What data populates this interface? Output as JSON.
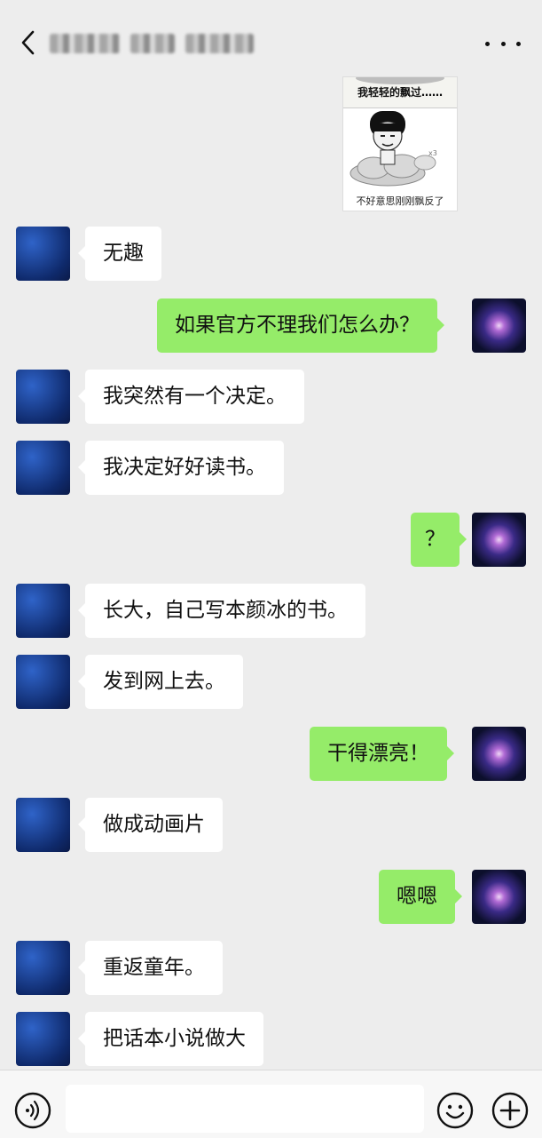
{
  "header": {
    "title_blurred": true
  },
  "sticker": {
    "caption_top": "我轻轻的飘过……",
    "caption_bottom": "不好意思刚刚飘反了"
  },
  "messages": [
    {
      "side": "left",
      "text": "无趣"
    },
    {
      "side": "right",
      "text": "如果官方不理我们怎么办？"
    },
    {
      "side": "left",
      "text": "我突然有一个决定。"
    },
    {
      "side": "left",
      "text": "我决定好好读书。"
    },
    {
      "side": "right",
      "text": "？"
    },
    {
      "side": "left",
      "text": "长大，自己写本颜冰的书。"
    },
    {
      "side": "left",
      "text": "发到网上去。"
    },
    {
      "side": "right",
      "text": "干得漂亮！"
    },
    {
      "side": "left",
      "text": "做成动画片"
    },
    {
      "side": "right",
      "text": "嗯嗯"
    },
    {
      "side": "left",
      "text": "重返童年。"
    },
    {
      "side": "left",
      "text": "把话本小说做大"
    }
  ],
  "icons": {
    "back": "chevron-left-icon",
    "more": "more-dots-icon",
    "voice": "voice-icon",
    "emoji": "emoji-icon",
    "plus": "plus-icon"
  },
  "colors": {
    "background": "#ededed",
    "bubble_self": "#95ec69",
    "bubble_other": "#ffffff"
  }
}
